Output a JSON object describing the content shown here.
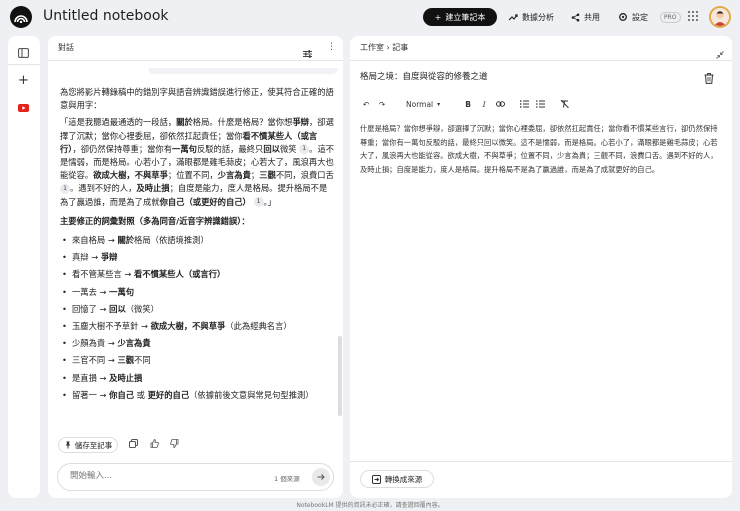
{
  "app": {
    "title": "Untitled notebook",
    "footer_note": "NotebookLM 提供的資訊未必正確，請查證回覆內容。"
  },
  "header": {
    "create_label": "建立筆記本",
    "analytics_label": "數據分析",
    "share_label": "共用",
    "settings_label": "設定",
    "pro_badge": "PRO"
  },
  "chat": {
    "header": "對話",
    "intro": "為您將影片轉錄稿中的錯別字與語音辨識錯誤進行修正，使其符合正確的語意與用字：",
    "quote": {
      "segments": [
        {
          "t": "「這是我聽過最通透的一段話，",
          "b": false
        },
        {
          "t": "關於",
          "b": true
        },
        {
          "t": "格局。什麼是格局？當你想",
          "b": false
        },
        {
          "t": "爭辯",
          "b": true
        },
        {
          "t": "，卻選擇了沉默；當你心裡委屈，卻依然扛起責任；當你",
          "b": false
        },
        {
          "t": "看不慣某些人（或言行）",
          "b": true
        },
        {
          "t": "，卻仍然保持尊重；當你有",
          "b": false
        },
        {
          "t": "一萬句",
          "b": true
        },
        {
          "t": "反駁的話，最終只",
          "b": false
        },
        {
          "t": "回以",
          "b": true
        },
        {
          "t": "微笑 ",
          "b": false
        }
      ],
      "segments2": [
        {
          "t": "。這不是懦弱，而是格局。心若小了，滿眼都是雞毛蒜皮；心若大了，風浪再大也能從容。",
          "b": false
        },
        {
          "t": "欲成大樹，不與草爭",
          "b": true
        },
        {
          "t": "；位置不同，",
          "b": false
        },
        {
          "t": "少言為貴",
          "b": true
        },
        {
          "t": "；",
          "b": false
        },
        {
          "t": "三觀",
          "b": true
        },
        {
          "t": "不同，浪費口舌 ",
          "b": false
        }
      ],
      "segments3": [
        {
          "t": "。遇到不好的人，",
          "b": false
        },
        {
          "t": "及時止損",
          "b": true
        },
        {
          "t": "；自度是能力，度人是格局。提升格局不是為了贏過誰，而是為了成就",
          "b": false
        },
        {
          "t": "你自己（或更好的自己）",
          "b": true
        },
        {
          "t": " ",
          "b": false
        }
      ],
      "end": "。」",
      "cite1": "1",
      "cite2": "1",
      "cite3": "1"
    },
    "list_title": "主要修正的詞彙對照（多為同音/近音字辨識錯誤）：",
    "corrections": [
      {
        "from": "來自格局",
        "to": "關於",
        "to_rest": "格局",
        "note": "（依語境推測）",
        "bold_full": false
      },
      {
        "from": "真辯",
        "to": "爭辯",
        "to_rest": "",
        "note": "",
        "bold_full": false
      },
      {
        "from": "看不管某些言",
        "to": "看不慣某些人（或言行）",
        "to_rest": "",
        "note": "",
        "bold_full": false
      },
      {
        "from": "一萬去",
        "to": "一萬句",
        "to_rest": "",
        "note": "",
        "bold_full": false
      },
      {
        "from": "回憶了",
        "to": "回以",
        "to_rest": "",
        "note": "（微笑）",
        "bold_full": false
      },
      {
        "from": "玉塵大樹不予草針",
        "to": "欲成大樹，不與草爭",
        "to_rest": "",
        "note": "（此為經典名言）",
        "bold_full": false
      },
      {
        "from": "少顏為貴",
        "to": "少言為貴",
        "to_rest": "",
        "note": "",
        "bold_full": false
      },
      {
        "from": "三官不同",
        "to": "三觀",
        "to_rest": "不同",
        "note": "",
        "bold_full": false
      },
      {
        "from": "是直損",
        "to": "及時止損",
        "to_rest": "",
        "note": "",
        "bold_full": false
      }
    ],
    "last_item": {
      "from": "留著一",
      "to1": "你自己",
      "or": "或",
      "to2": "更好的自己",
      "note": "（依據前後文意與常見句型推測）"
    },
    "save_label": "儲存至記事",
    "input_placeholder": "開始輸入...",
    "source_count": "1 個來源"
  },
  "studio": {
    "breadcrumb_root": "工作室",
    "breadcrumb_page": "記事",
    "note_title": "格局之境：自度與從容的修養之道",
    "style_select": "Normal",
    "body": "什麼是格局？當你想爭辯，卻選擇了沉默；當你心裡委屈，卻依然扛起責任；當你看不慣某些言行，卻仍然保持尊重；當你有一萬句反駁的話，最終只回以微笑。這不是懦弱，而是格局。心若小了，滿眼都是雞毛蒜皮；心若大了，風浪再大也能從容。欲成大樹，不與草爭；位置不同，少言為貴；三觀不同，浪費口舌。遇到不好的人，及時止損；自度是能力，度人是格局。提升格局不是為了贏過誰，而是為了成就更好的自己。",
    "convert_label": "轉換成來源"
  }
}
